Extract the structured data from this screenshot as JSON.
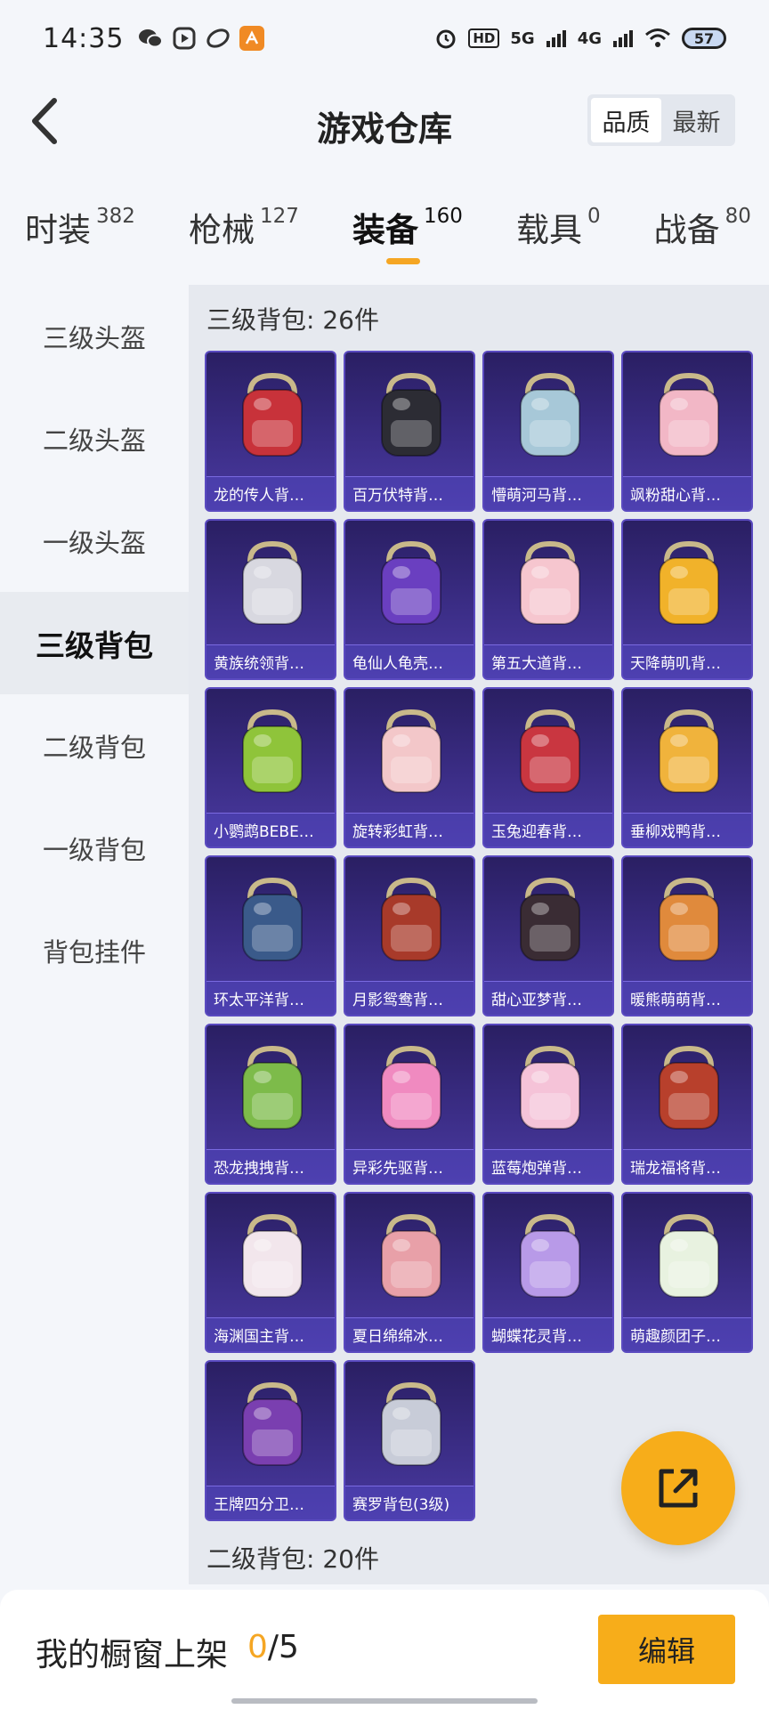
{
  "status_bar": {
    "time": "14:35",
    "network1": "HD",
    "network2": "5G",
    "network3": "4G",
    "battery": "57"
  },
  "header": {
    "title": "游戏仓库",
    "sort_options": [
      "品质",
      "最新"
    ],
    "active_sort": "品质"
  },
  "category_tabs": [
    {
      "label": "时装",
      "count": "382"
    },
    {
      "label": "枪械",
      "count": "127"
    },
    {
      "label": "装备",
      "count": "160",
      "active": true
    },
    {
      "label": "载具",
      "count": "0"
    },
    {
      "label": "战备",
      "count": "80"
    }
  ],
  "side_nav": [
    "三级头盔",
    "二级头盔",
    "一级头盔",
    "三级背包",
    "二级背包",
    "一级背包",
    "背包挂件"
  ],
  "side_nav_active": "三级背包",
  "sections": [
    {
      "title": "三级背包: 26件"
    },
    {
      "title": "二级背包: 20件"
    }
  ],
  "items": [
    {
      "name": "龙的传人背…",
      "icon": "red-gold-backpack",
      "color": "#c8323a"
    },
    {
      "name": "百万伏特背…",
      "icon": "robot-astronaut-backpack",
      "color": "#2c2c34"
    },
    {
      "name": "懵萌河马背…",
      "icon": "hippo-backpack",
      "color": "#a7c8d8"
    },
    {
      "name": "飒粉甜心背…",
      "icon": "pink-backpack",
      "color": "#f2b7c6"
    },
    {
      "name": "黄族统领背…",
      "icon": "armored-backpack",
      "color": "#d8d8e0"
    },
    {
      "name": "龟仙人龟壳…",
      "icon": "turtle-shell-backpack",
      "color": "#6a3fc0"
    },
    {
      "name": "第五大道背…",
      "icon": "pink-quilted-backpack",
      "color": "#f6c6cf"
    },
    {
      "name": "天降萌叽背…",
      "icon": "yellow-backpack",
      "color": "#f1b22a"
    },
    {
      "name": "小鹦鹉BEBE…",
      "icon": "parrot-backpack",
      "color": "#8fc43a"
    },
    {
      "name": "旋转彩虹背…",
      "icon": "rainbow-cake-backpack",
      "color": "#f3c7c9"
    },
    {
      "name": "玉兔迎春背…",
      "icon": "rabbit-red-backpack",
      "color": "#c93640"
    },
    {
      "name": "垂柳戏鸭背…",
      "icon": "duck-backpack",
      "color": "#f0b33c"
    },
    {
      "name": "环太平洋背…",
      "icon": "mech-backpack",
      "color": "#3a5a8a"
    },
    {
      "name": "月影鸳鸯背…",
      "icon": "wing-backpack",
      "color": "#a83a2a"
    },
    {
      "name": "甜心亚梦背…",
      "icon": "black-red-backpack",
      "color": "#3a2c34"
    },
    {
      "name": "暖熊萌萌背…",
      "icon": "bear-backpack",
      "color": "#e08a3c"
    },
    {
      "name": "恐龙拽拽背…",
      "icon": "dino-backpack",
      "color": "#7dbb4a"
    },
    {
      "name": "异彩先驱背…",
      "icon": "monster-backpack",
      "color": "#f08ac0"
    },
    {
      "name": "蓝莓炮弹背…",
      "icon": "dessert-backpack",
      "color": "#f5c3d8"
    },
    {
      "name": "瑞龙福将背…",
      "icon": "dragon-armor-backpack",
      "color": "#b8402c"
    },
    {
      "name": "海渊国主背…",
      "icon": "white-pink-backpack",
      "color": "#f2e6ec"
    },
    {
      "name": "夏日绵绵冰…",
      "icon": "icecream-backpack",
      "color": "#e8a0a8"
    },
    {
      "name": "蝴蝶花灵背…",
      "icon": "butterfly-backpack",
      "color": "#b89ae8"
    },
    {
      "name": "萌趣颜团子…",
      "icon": "dumpling-backpack",
      "color": "#e8f2e0"
    },
    {
      "name": "王牌四分卫…",
      "icon": "purple-shield-backpack",
      "color": "#7a3fb0"
    },
    {
      "name": "赛罗背包(3级)",
      "icon": "ultraman-backpack",
      "color": "#c8ccd8"
    }
  ],
  "fab": {
    "icon": "share-icon"
  },
  "bottom": {
    "label": "我的橱窗上架",
    "current": "0",
    "sep": "/",
    "max": "5",
    "edit": "编辑"
  }
}
